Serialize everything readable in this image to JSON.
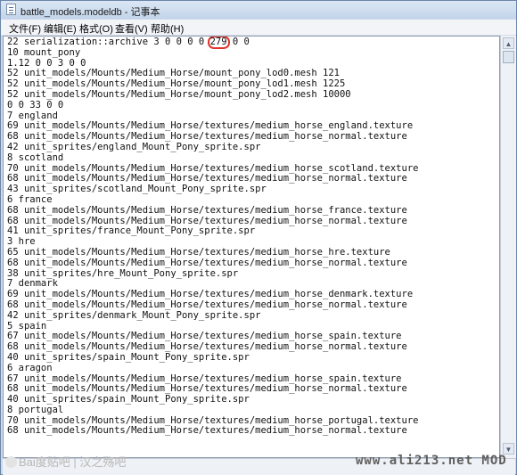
{
  "window": {
    "title": "battle_models.modeldb - 记事本"
  },
  "menu": [
    {
      "label": "文件(F)"
    },
    {
      "label": "编辑(E)"
    },
    {
      "label": "格式(O)"
    },
    {
      "label": "查看(V)"
    },
    {
      "label": "帮助(H)"
    }
  ],
  "doc": {
    "line1_prefix": "22 serialization::archive 3 0 0 0 0 ",
    "line1_highlight": "279",
    "line1_suffix": " 0 0",
    "body": "\n10 mount_pony\n1.12 0 0 3 0 0\n52 unit_models/Mounts/Medium_Horse/mount_pony_lod0.mesh 121\n52 unit_models/Mounts/Medium_Horse/mount_pony_lod1.mesh 1225\n52 unit_models/Mounts/Medium_Horse/mount_pony_lod2.mesh 10000\n0 0 33 0 0\n7 england\n69 unit_models/Mounts/Medium_Horse/textures/medium_horse_england.texture\n68 unit_models/Mounts/Medium_Horse/textures/medium_horse_normal.texture\n42 unit_sprites/england_Mount_Pony_sprite.spr\n8 scotland\n70 unit_models/Mounts/Medium_Horse/textures/medium_horse_scotland.texture\n68 unit_models/Mounts/Medium_Horse/textures/medium_horse_normal.texture\n43 unit_sprites/scotland_Mount_Pony_sprite.spr\n6 france\n68 unit_models/Mounts/Medium_Horse/textures/medium_horse_france.texture\n68 unit_models/Mounts/Medium_Horse/textures/medium_horse_normal.texture\n41 unit_sprites/france_Mount_Pony_sprite.spr\n3 hre\n65 unit_models/Mounts/Medium_Horse/textures/medium_horse_hre.texture\n68 unit_models/Mounts/Medium_Horse/textures/medium_horse_normal.texture\n38 unit_sprites/hre_Mount_Pony_sprite.spr\n7 denmark\n69 unit_models/Mounts/Medium_Horse/textures/medium_horse_denmark.texture\n68 unit_models/Mounts/Medium_Horse/textures/medium_horse_normal.texture\n42 unit_sprites/denmark_Mount_Pony_sprite.spr\n5 spain\n67 unit_models/Mounts/Medium_Horse/textures/medium_horse_spain.texture\n68 unit_models/Mounts/Medium_Horse/textures/medium_horse_normal.texture\n40 unit_sprites/spain_Mount_Pony_sprite.spr\n6 aragon\n67 unit_models/Mounts/Medium_Horse/textures/medium_horse_spain.texture\n68 unit_models/Mounts/Medium_Horse/textures/medium_horse_normal.texture\n40 unit_sprites/spain_Mount_Pony_sprite.spr\n8 portugal\n70 unit_models/Mounts/Medium_Horse/textures/medium_horse_portugal.texture\n68 unit_models/Mounts/Medium_Horse/textures/medium_horse_normal.texture"
  },
  "watermarks": {
    "left": "Bai度贴吧 | 汉之殇吧",
    "right": "www.ali213.net MOD"
  },
  "colors": {
    "highlight_circle": "#e0352b",
    "titlebar": "#c3d4ea"
  }
}
